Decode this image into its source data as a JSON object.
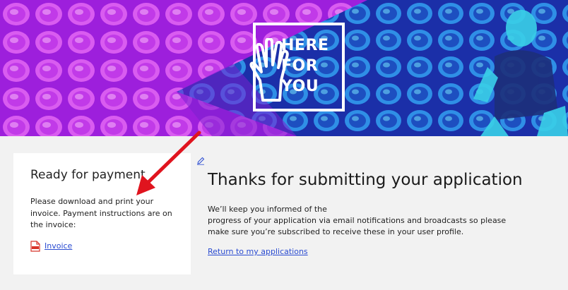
{
  "hero": {
    "logo_lines": [
      "HERE",
      "FOR",
      "YOU"
    ],
    "logo_icon": "raised-hand-icon"
  },
  "payment_card": {
    "title": "Ready for payment",
    "body": "Please download and print your invoice. Payment instructions are on the invoice:",
    "invoice_icon": "pdf-icon",
    "invoice_label": "Invoice"
  },
  "main": {
    "edit_icon": "pencil-icon",
    "title": "Thanks for submitting your application",
    "body_lines": [
      "We’ll keep you informed of the",
      "progress of your application via email notifications and broadcasts so please",
      "make sure you’re subscribed to receive these in your user profile."
    ],
    "return_link": "Return to my applications"
  },
  "colors": {
    "link": "#2a4bd1",
    "annotation_arrow": "#e0141e",
    "banner_magenta": "#b11fe0",
    "banner_blue": "#1a5bd8"
  }
}
